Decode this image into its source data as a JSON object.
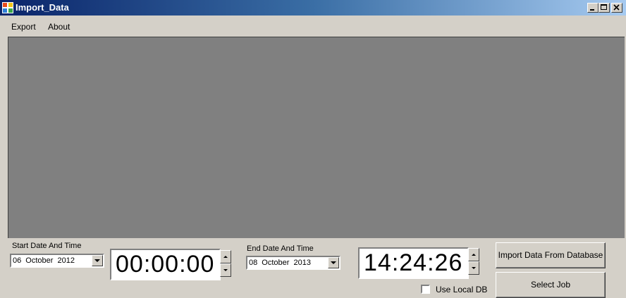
{
  "window": {
    "title": "Import_Data"
  },
  "menu": [
    {
      "label": "Export"
    },
    {
      "label": "About"
    }
  ],
  "start": {
    "label": "Start Date And Time",
    "date": "06 October 2012",
    "time": "00:00:00"
  },
  "end": {
    "label": "End Date And Time",
    "date": "08 October 2013",
    "time": "14:24:26"
  },
  "buttons": {
    "import": "Import Data From Database",
    "select_job": "Select Job"
  },
  "use_local_db": {
    "label": "Use Local DB",
    "checked": false
  },
  "colors": {
    "content_bg": "#808080",
    "window_bg": "#d4d0c8",
    "title_start": "#0a246a",
    "title_end": "#a6caf0"
  },
  "icons": {
    "app": "app-icon",
    "minimize": "minimize-icon",
    "maximize": "maximize-icon",
    "close": "close-icon"
  }
}
